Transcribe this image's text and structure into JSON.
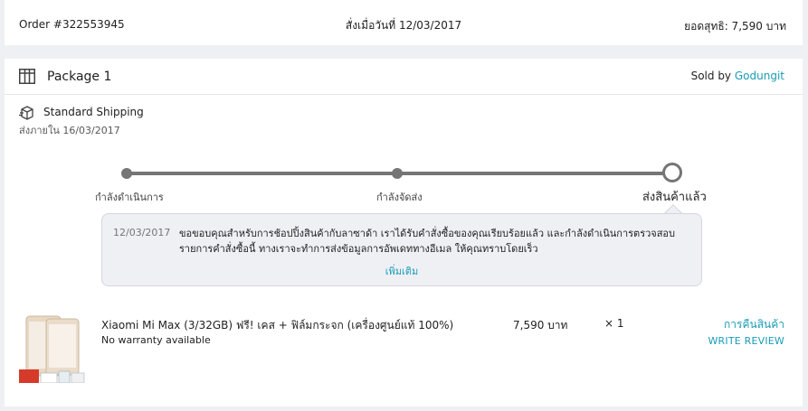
{
  "order": {
    "id_text": "Order #322553945",
    "placed_date_text": "สั่งเมื่อวันที่ 12/03/2017",
    "total_text": "ยอดสุทธิ: 7,590 บาท"
  },
  "package": {
    "title": "Package 1",
    "sold_by_label": "Sold by",
    "seller_name": "Godungit",
    "shipping": {
      "method": "Standard Shipping",
      "eta": "ส่งภายใน 16/03/2017"
    },
    "progress": {
      "steps": [
        {
          "label": "กำลังดำเนินการ"
        },
        {
          "label": "กำลังจัดส่ง"
        },
        {
          "label": "ส่งสินค้าแล้ว"
        }
      ],
      "current_step": 3
    },
    "status_update": {
      "date": "12/03/2017",
      "message_line1": "ขอขอบคุณสำหรับการช้อปปิ้งสินค้ากับลาซาด้า เราได้รับคำสั่งซื้อของคุณเรียบร้อยแล้ว และกำลังดำเนินการตรวจสอบ",
      "message_line2": "รายการคำสั่งซื้อนี้ ทางเราจะทำการส่งข้อมูลการอัพเดททางอีเมล ให้คุณทราบโดยเร็ว",
      "more_link": "เพิ่มเติม"
    },
    "item": {
      "name": "Xiaomi Mi Max (3/32GB) ฟรี! เคส + ฟิล์มกระจก (เครื่องศูนย์แท้ 100%)",
      "warranty": "No warranty available",
      "price": "7,590 บาท",
      "quantity": "× 1",
      "return_link": "การคืนสินค้า",
      "review_link": "WRITE REVIEW"
    }
  },
  "colors": {
    "link": "#1a9cb7",
    "progress": "#757575",
    "page_bg": "#eff0f4"
  }
}
